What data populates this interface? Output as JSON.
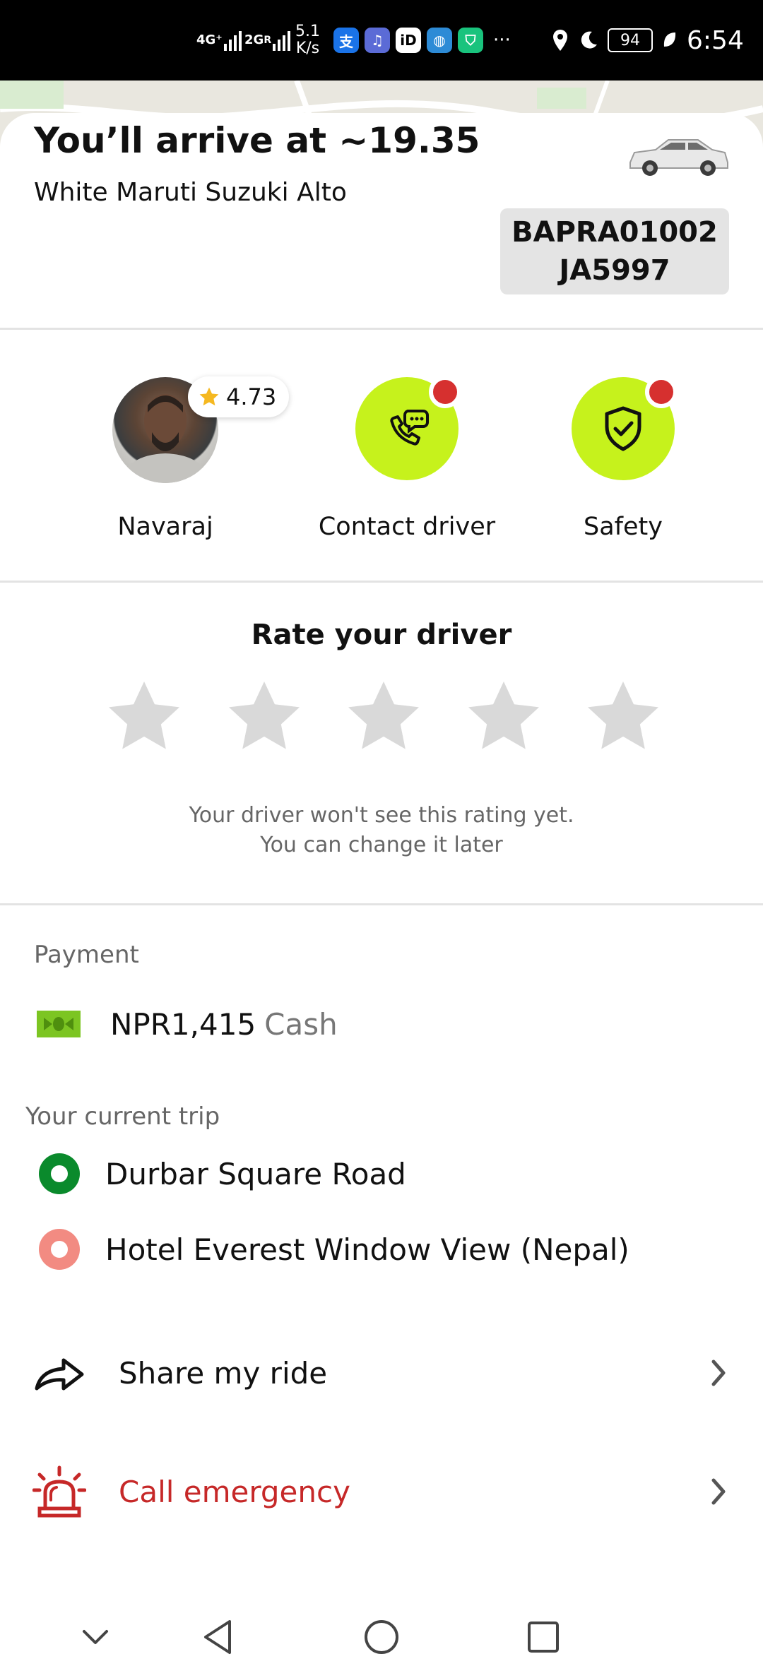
{
  "status_bar": {
    "network_1": "4G⁺",
    "network_2": "2G",
    "network_2_suffix": "R",
    "speed_value": "5.1",
    "speed_unit": "K/s",
    "battery": "94",
    "time": "6:54",
    "more": "···"
  },
  "trip_header": {
    "arrive_text": "You’ll arrive at ~19.35",
    "car_description": "White Maruti Suzuki Alto",
    "plate_line1": "BAPRA01002",
    "plate_line2": "JA5997"
  },
  "driver": {
    "name": "Navaraj",
    "rating": "4.73"
  },
  "actions": {
    "contact_label": "Contact driver",
    "safety_label": "Safety"
  },
  "rating_section": {
    "title": "Rate your driver",
    "stars_total": 5,
    "stars_selected": 0,
    "note_line1": "Your driver won't see this rating yet.",
    "note_line2": "You can change it later"
  },
  "payment": {
    "label": "Payment",
    "amount": "NPR1,415",
    "method": "Cash"
  },
  "trip": {
    "label": "Your current trip",
    "pickup": "Durbar Square Road",
    "dropoff": "Hotel Everest Window View (Nepal)"
  },
  "menu": {
    "share_label": "Share my ride",
    "emergency_label": "Call emergency"
  },
  "colors": {
    "accent_green": "#c6f21c",
    "pickup_green": "#0a8a2c",
    "dropoff_pink": "#f28b82",
    "emergency_red": "#c62828",
    "notification_red": "#d6302f"
  }
}
